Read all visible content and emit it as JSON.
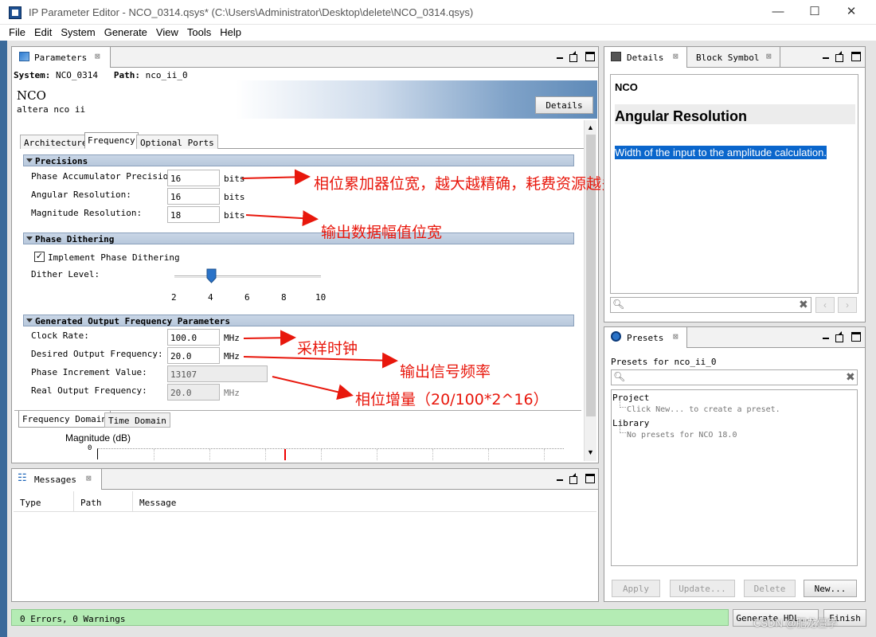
{
  "window": {
    "title": "IP Parameter Editor - NCO_0314.qsys* (C:\\Users\\Administrator\\Desktop\\delete\\NCO_0314.qsys)",
    "minimize": "—",
    "maximize": "☐",
    "close": "✕"
  },
  "menu": [
    "File",
    "Edit",
    "System",
    "Generate",
    "View",
    "Tools",
    "Help"
  ],
  "parameters_panel": {
    "tab_label": "Parameters",
    "system_label": "System:",
    "system_value": "NCO_0314",
    "path_label": "Path:",
    "path_value": "nco_ii_0",
    "component_title": "NCO",
    "component_subtitle": "altera nco ii",
    "details_button": "Details",
    "tabs": [
      "Architecture",
      "Frequency",
      "Optional Ports"
    ],
    "active_tab": "Frequency",
    "precisions": {
      "header": "Precisions",
      "rows": [
        {
          "label": "Phase Accumulator Precision:",
          "value": "16",
          "unit": "bits"
        },
        {
          "label": "Angular Resolution:",
          "value": "16",
          "unit": "bits"
        },
        {
          "label": "Magnitude Resolution:",
          "value": "18",
          "unit": "bits"
        }
      ]
    },
    "phase_dithering": {
      "header": "Phase Dithering",
      "checkbox_label": "Implement Phase Dithering",
      "checked": true,
      "dither_label": "Dither Level:",
      "slider_ticks": [
        "2",
        "4",
        "6",
        "8",
        "10"
      ],
      "slider_value": 4
    },
    "generated_output": {
      "header": "Generated Output Frequency Parameters",
      "rows": [
        {
          "label": "Clock Rate:",
          "value": "100.0",
          "unit": "MHz",
          "readonly": false
        },
        {
          "label": "Desired Output Frequency:",
          "value": "20.0",
          "unit": "MHz",
          "readonly": false
        },
        {
          "label": "Phase Increment Value:",
          "value": "13107",
          "unit": "",
          "readonly": true
        },
        {
          "label": "Real Output Frequency:",
          "value": "20.0",
          "unit": "MHz",
          "readonly": true
        }
      ]
    },
    "domain_tabs": [
      "Frequency Domain",
      "Time Domain"
    ],
    "plot_label": "Magnitude (dB)",
    "plot_y_tick": "0"
  },
  "annotations": {
    "phase_acc": "相位累加器位宽，越大越精确，耗费资源越多",
    "magnitude": "输出数据幅值位宽",
    "clock": "采样时钟",
    "output_freq": "输出信号频率",
    "phase_inc": "相位增量（20/100*2^16）"
  },
  "messages_panel": {
    "tab_label": "Messages",
    "columns": [
      "Type",
      "Path",
      "Message"
    ]
  },
  "details_panel": {
    "tabs": [
      "Details",
      "Block Symbol"
    ],
    "heading": "NCO",
    "param_title": "Angular Resolution",
    "description": "Width of the input to the amplitude calculation."
  },
  "presets_panel": {
    "tab_label": "Presets",
    "presets_for": "Presets for nco_ii_0",
    "tree": {
      "project": "Project",
      "project_hint": "Click New... to create a preset.",
      "library": "Library",
      "library_hint": "No presets for NCO 18.0"
    },
    "buttons": [
      "Apply",
      "Update...",
      "Delete",
      "New..."
    ]
  },
  "status": {
    "text": "0 Errors, 0 Warnings",
    "generate_hdl": "Generate HDL...",
    "finish": "Finish",
    "watermark": "CSDN @肥龙僵学"
  },
  "colors": {
    "accent_blue": "#1a63b8",
    "annotation_red": "#e8170c",
    "status_green": "#b4ecb4"
  }
}
